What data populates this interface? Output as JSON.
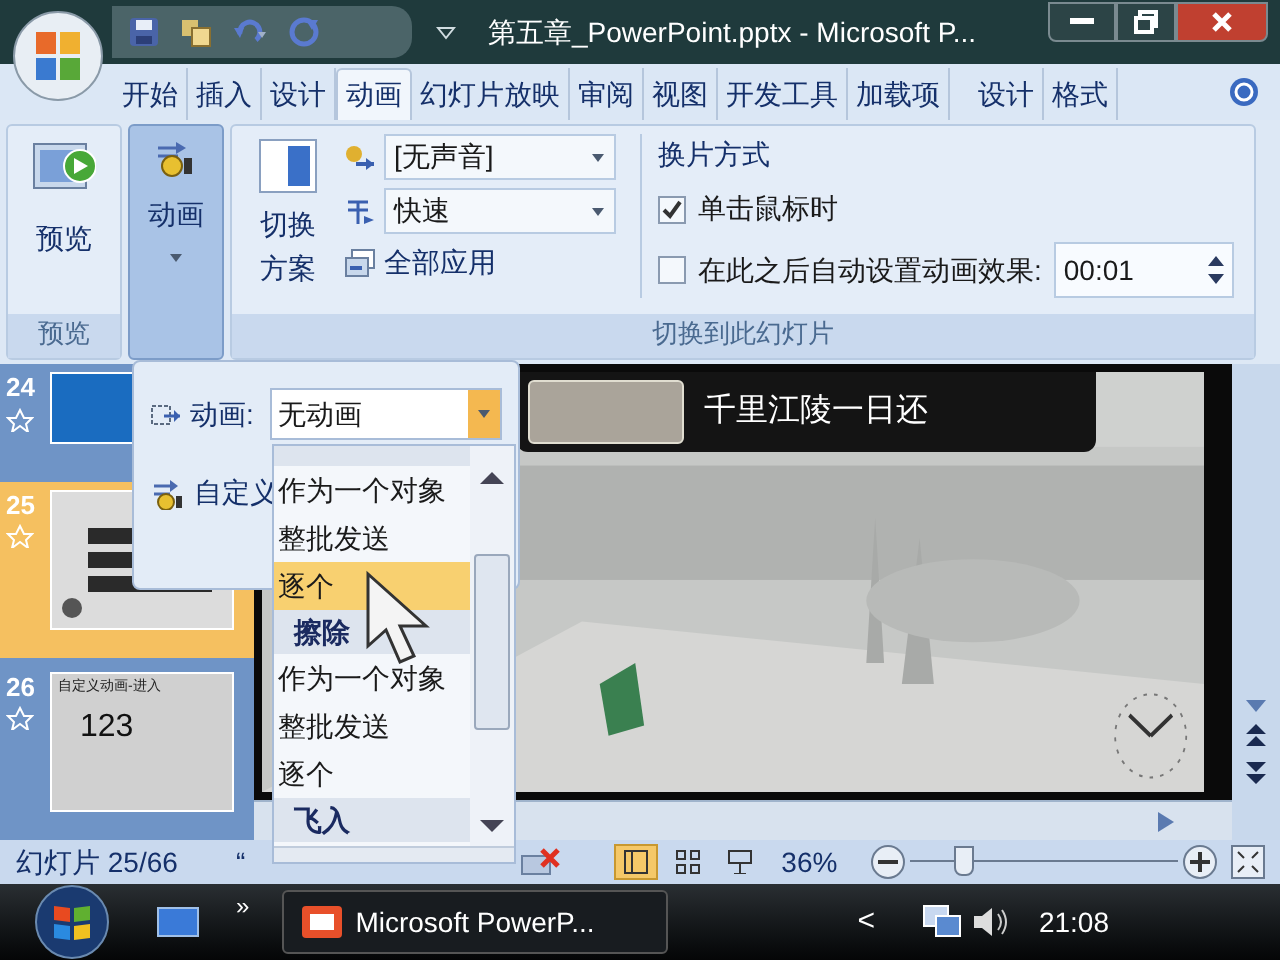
{
  "window": {
    "title": "第五章_PowerPoint.pptx - Microsoft P..."
  },
  "ribbon_tabs": [
    {
      "label": "开始",
      "selected": false
    },
    {
      "label": "插入",
      "selected": false
    },
    {
      "label": "设计",
      "selected": false
    },
    {
      "label": "动画",
      "selected": true
    },
    {
      "label": "幻灯片放映",
      "selected": false
    },
    {
      "label": "审阅",
      "selected": false
    },
    {
      "label": "视图",
      "selected": false
    },
    {
      "label": "开发工具",
      "selected": false
    },
    {
      "label": "加载项",
      "selected": false
    },
    {
      "label": "设计",
      "selected": false
    },
    {
      "label": "格式",
      "selected": false
    }
  ],
  "ribbon": {
    "preview": {
      "button": "预览",
      "group": "预览"
    },
    "animation_button": {
      "label": "动画",
      "selected": true
    },
    "transition": {
      "scheme_button": "切换方案",
      "sound": "[无声音]",
      "speed": "快速",
      "apply_all": "全部应用",
      "advance_title": "换片方式",
      "on_click": {
        "label": "单击鼠标时",
        "checked": true
      },
      "after": {
        "label": "在此之后自动设置动画效果:",
        "checked": false,
        "value": "00:01"
      },
      "group": "切换到此幻灯片"
    }
  },
  "slides": [
    {
      "number": "24",
      "selected": false,
      "kind": "blank"
    },
    {
      "number": "25",
      "selected": true,
      "kind": "picture"
    },
    {
      "number": "26",
      "selected": false,
      "kind": "title",
      "title": "自定义动画-进入",
      "text": "123"
    }
  ],
  "slide": {
    "caption": "千里江陵一日还"
  },
  "animation_panel": {
    "label": "动画:",
    "value": "无动画",
    "custom": "自定义"
  },
  "animation_menu": [
    {
      "kind": "item",
      "label": "作为一个对象",
      "selected": false
    },
    {
      "kind": "item",
      "label": "整批发送",
      "selected": false
    },
    {
      "kind": "item",
      "label": "逐个",
      "selected": true
    },
    {
      "kind": "header",
      "label": "擦除"
    },
    {
      "kind": "item",
      "label": "作为一个对象",
      "selected": false
    },
    {
      "kind": "item",
      "label": "整批发送",
      "selected": false
    },
    {
      "kind": "item",
      "label": "逐个",
      "selected": false
    },
    {
      "kind": "header",
      "label": "飞入"
    }
  ],
  "status_bar": {
    "slide": "幻灯片 25/66",
    "theme": "“",
    "zoom": "36%",
    "zoom_slider": {
      "level": 0.18
    }
  },
  "taskbar": {
    "more": "»",
    "task": "Microsoft PowerP...",
    "tray_toggle": "<",
    "clock": "21:08"
  }
}
